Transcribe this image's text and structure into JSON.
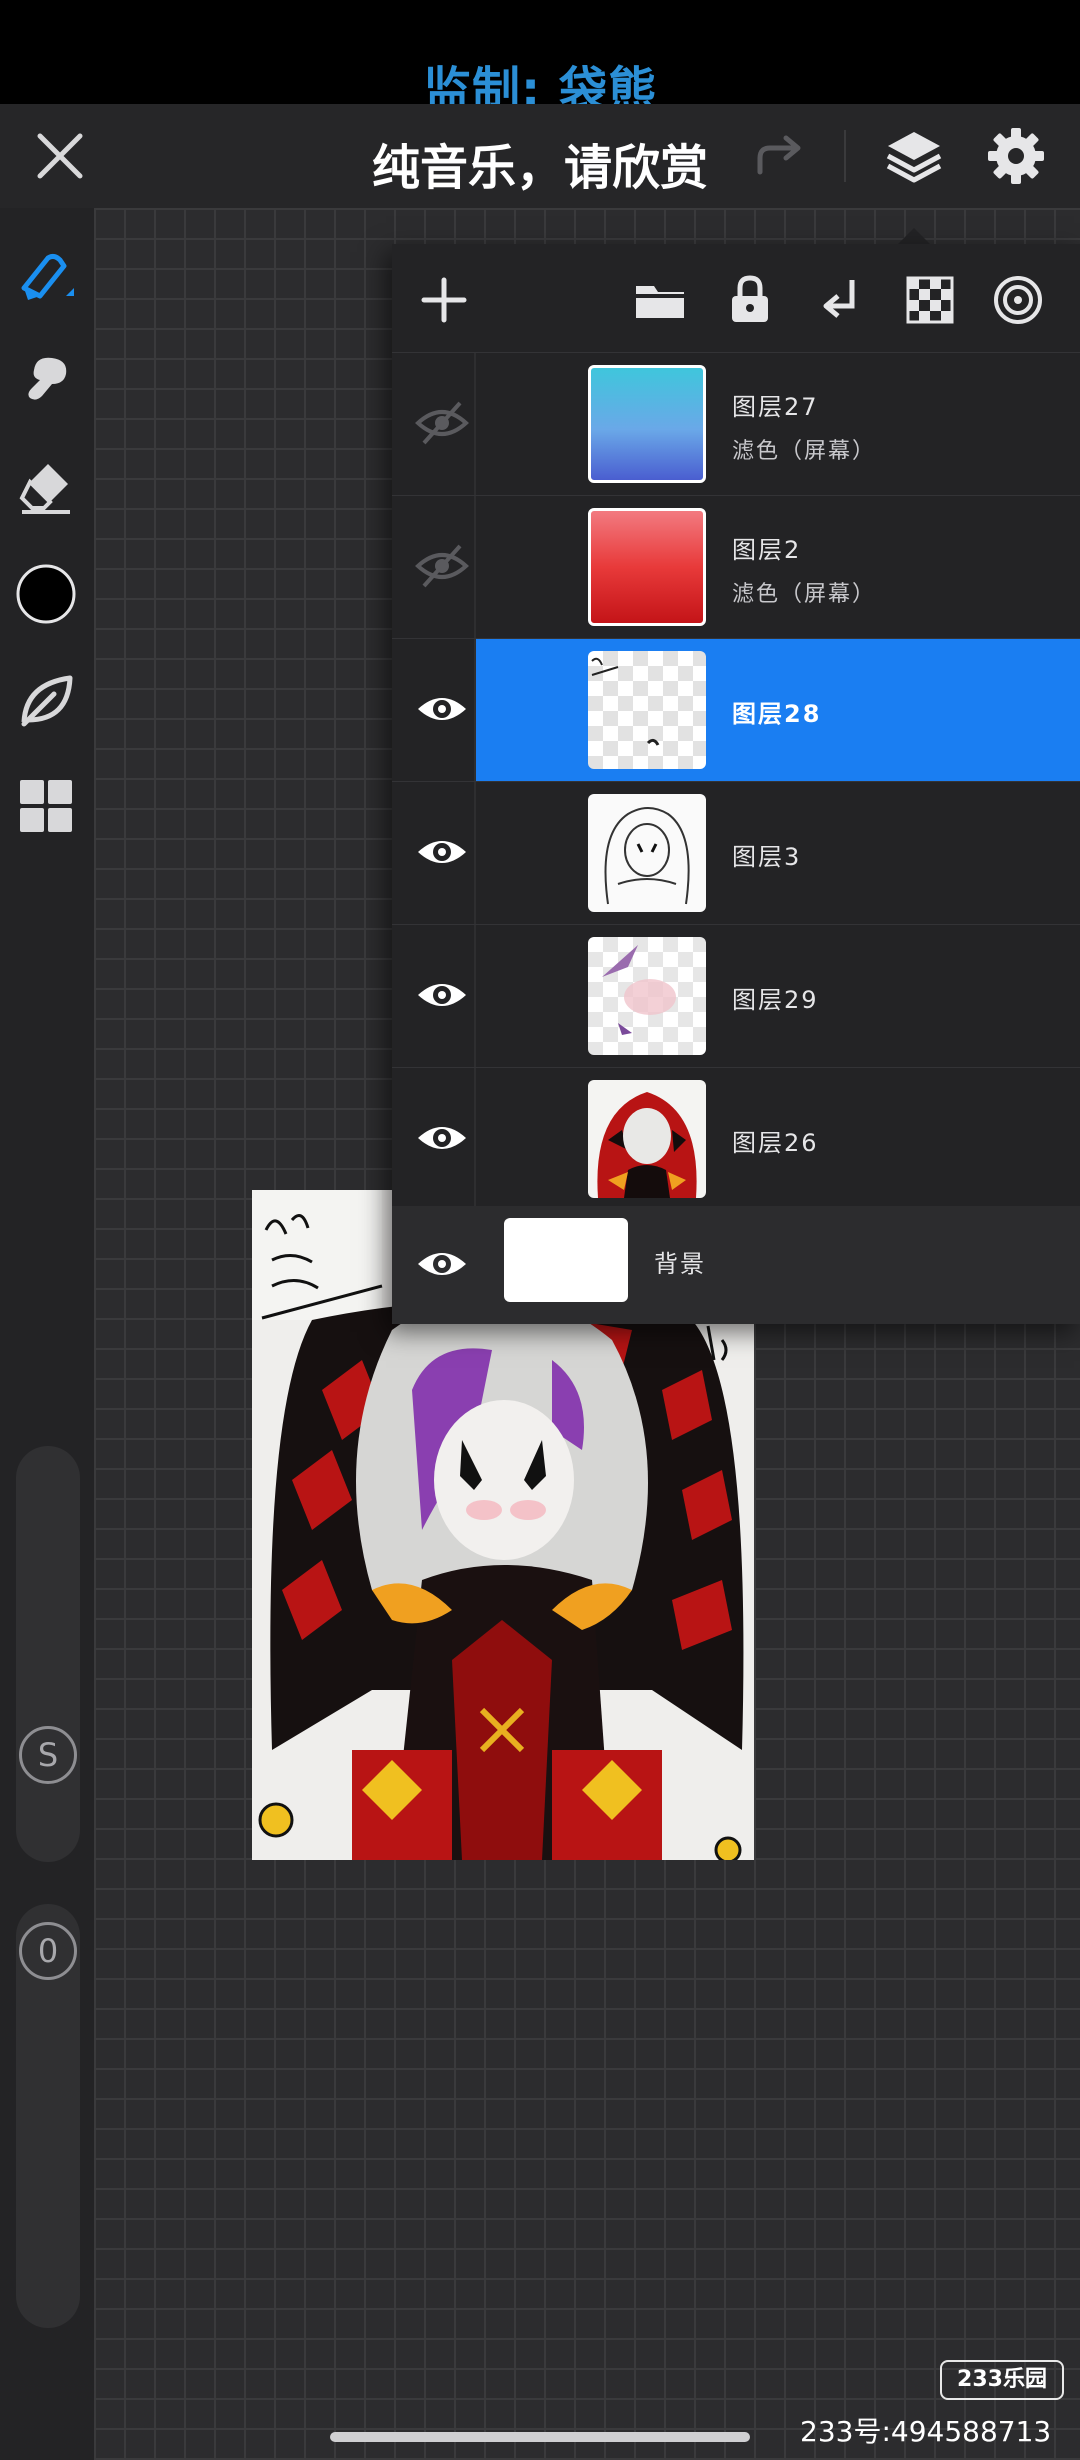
{
  "overlay": {
    "title": "监制: 袋熊"
  },
  "toolbar": {
    "caption": "纯音乐，请欣赏",
    "close_icon": "close-icon",
    "redo_icon": "redo-icon",
    "layers_icon": "layers-icon",
    "settings_icon": "gear-icon"
  },
  "tools": [
    {
      "name": "brush-tool",
      "icon": "pen-icon",
      "active": true
    },
    {
      "name": "smudge-tool",
      "icon": "smudge-icon"
    },
    {
      "name": "eraser-tool",
      "icon": "eraser-icon"
    },
    {
      "name": "color-swatch",
      "icon": "color-circle",
      "color": "#000000"
    },
    {
      "name": "leaf-tool",
      "icon": "leaf-icon"
    },
    {
      "name": "gallery-tool",
      "icon": "grid-icon"
    }
  ],
  "sliders": {
    "size_label": "S",
    "opacity_label": "0"
  },
  "layers_panel": {
    "toolbar_icons": [
      "add-icon",
      "folder-icon",
      "lock-icon",
      "merge-down-icon",
      "alpha-lock-icon",
      "blend-mode-icon"
    ],
    "layers": [
      {
        "name": "图层27",
        "blend": "滤色（屏幕）",
        "visible": false,
        "selected": false
      },
      {
        "name": "图层2",
        "blend": "滤色（屏幕）",
        "visible": false,
        "selected": false
      },
      {
        "name": "图层28",
        "blend": "",
        "visible": true,
        "selected": true
      },
      {
        "name": "图层3",
        "blend": "",
        "visible": true,
        "selected": false
      },
      {
        "name": "图层29",
        "blend": "",
        "visible": true,
        "selected": false
      },
      {
        "name": "图层26",
        "blend": "",
        "visible": true,
        "selected": false
      }
    ],
    "background": {
      "name": "背景",
      "visible": true
    }
  },
  "colors": {
    "accent": "#1a7ef2",
    "overlay_title": "#2b8fd6"
  },
  "watermark": {
    "logo": "233乐园",
    "id": "233号:494588713"
  }
}
